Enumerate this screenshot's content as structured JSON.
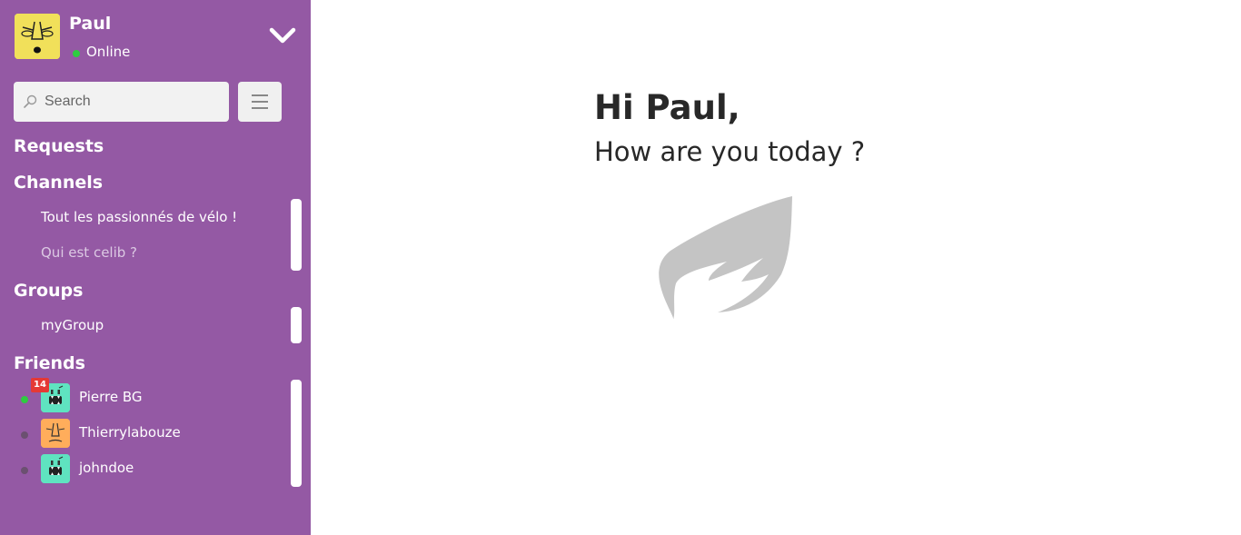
{
  "user": {
    "name": "Paul",
    "status": "Online",
    "status_color": "#2ecc40",
    "avatar_color": "#f1e05a"
  },
  "search": {
    "placeholder": "Search",
    "value": ""
  },
  "sections": {
    "requests": "Requests",
    "channels": "Channels",
    "groups": "Groups",
    "friends": "Friends"
  },
  "channels": [
    {
      "label": "Tout les passionnés de vélo !",
      "active": true
    },
    {
      "label": "Qui est celib ?",
      "active": false
    }
  ],
  "groups": [
    {
      "label": "myGroup"
    }
  ],
  "friends": [
    {
      "name": "Pierre BG",
      "online": true,
      "unread": "14",
      "avatar_color": "#5fe3c0"
    },
    {
      "name": "Thierrylabouze",
      "online": false,
      "unread": "",
      "avatar_color": "#ffad5b"
    },
    {
      "name": "johndoe",
      "online": false,
      "unread": "",
      "avatar_color": "#5fe3c0"
    }
  ],
  "main": {
    "greeting": "Hi Paul,",
    "subtitle": "How are you today ?",
    "logo_icon": "wing-icon"
  },
  "colors": {
    "sidebar": "#9459a4",
    "online": "#2ecc40",
    "offline": "#6b5070",
    "badge": "#e53935",
    "logo": "#c4c4c4"
  }
}
